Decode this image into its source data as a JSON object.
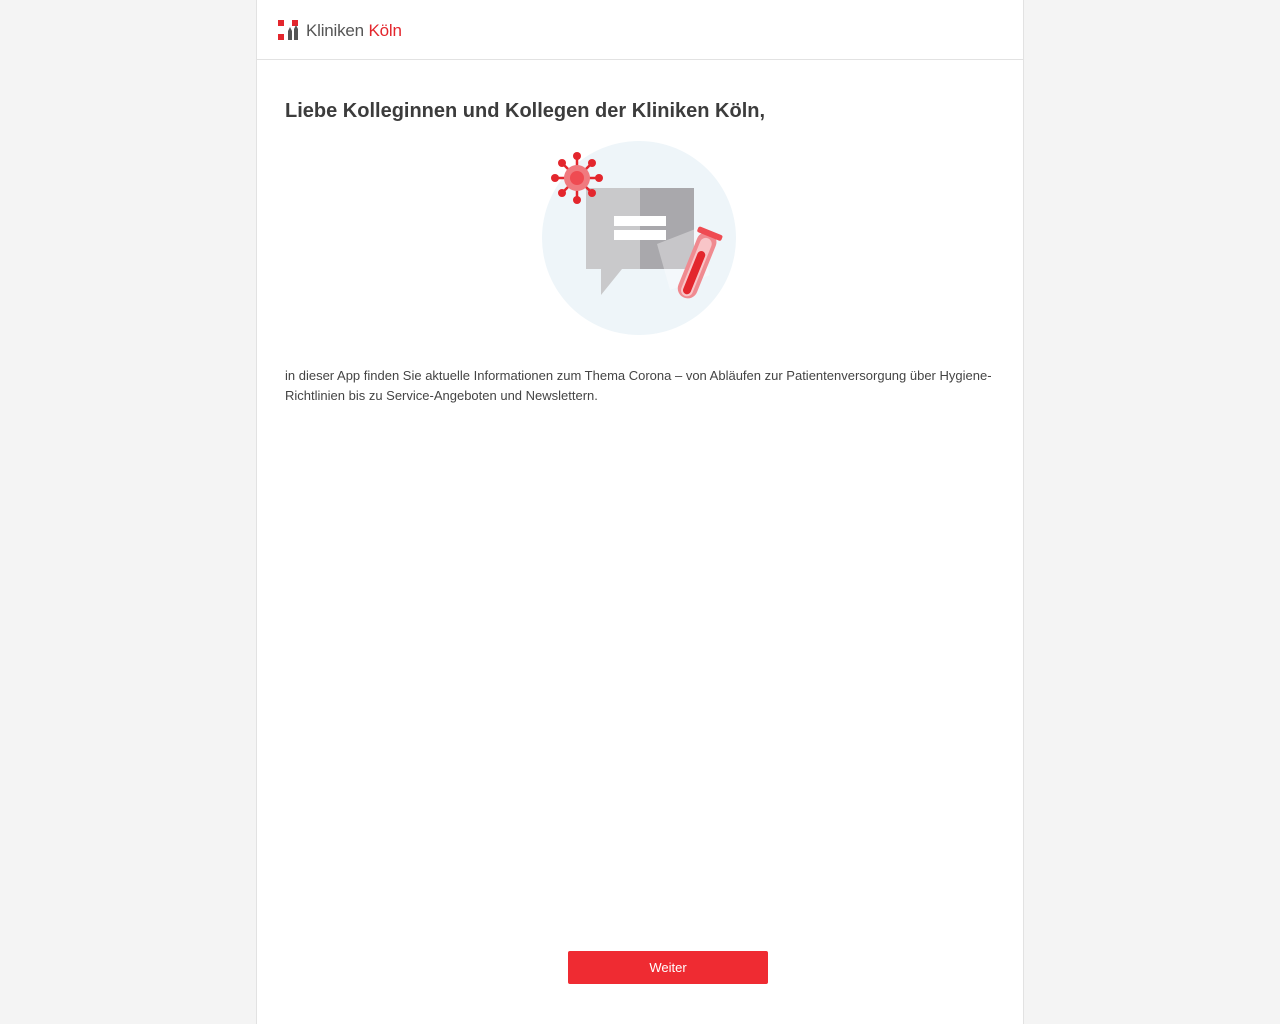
{
  "header": {
    "logo": {
      "text_part1": "Kliniken",
      "text_part2": "Köln",
      "brand_color": "#e3262d",
      "text_color": "#555555"
    }
  },
  "main": {
    "greeting": "Liebe Kolleginnen und Kollegen der Kliniken Köln,",
    "illustration_icon": "corona-info-chat-icon",
    "intro_text": "in dieser App finden Sie aktuelle Informationen zum Thema Corona – von Abläufen zur Patientenversorgung über Hygiene-Richtlinien bis zu Service-Angeboten und Newslettern."
  },
  "footer": {
    "next_button_label": "Weiter",
    "button_color": "#ef2b32"
  }
}
